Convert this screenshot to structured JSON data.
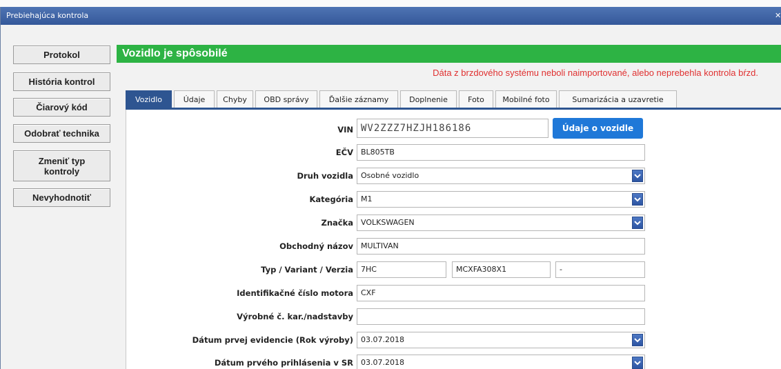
{
  "window": {
    "title": "Prebiehajúca kontrola",
    "close_icon": "close-icon"
  },
  "sidebar": {
    "items": [
      {
        "label": "Protokol"
      },
      {
        "label": "História kontrol"
      },
      {
        "label": "Čiarový kód"
      },
      {
        "label": "Odobrať technika"
      },
      {
        "label": "Zmeniť typ kontroly"
      },
      {
        "label": "Nevyhodnotiť"
      }
    ]
  },
  "status": {
    "title": "Vozidlo je spôsobilé",
    "color": "#2db344"
  },
  "warning": "Dáta z brzdového systému neboli naimportované, alebo neprebehla kontrola bŕzd.",
  "tabs": [
    {
      "label": "Vozidlo",
      "active": true
    },
    {
      "label": "Údaje"
    },
    {
      "label": "Chyby"
    },
    {
      "label": "OBD správy"
    },
    {
      "label": "Ďalšie záznamy"
    },
    {
      "label": "Doplnenie"
    },
    {
      "label": "Foto"
    },
    {
      "label": "Mobilné foto"
    },
    {
      "label": "Sumarizácia a uzavretie"
    }
  ],
  "form": {
    "vin_label": "VIN",
    "vin_value": "WV2ZZZ7HZJH186186",
    "vehicle_button": "Údaje o vozidle",
    "ecv_label": "EČV",
    "ecv_value": "BL805TB",
    "druh_label": "Druh vozidla",
    "druh_value": "Osobné vozidlo",
    "kategoria_label": "Kategória",
    "kategoria_value": "M1",
    "znacka_label": "Značka",
    "znacka_value": "VOLKSWAGEN",
    "obchodny_label": "Obchodný názov",
    "obchodny_value": "MULTIVAN",
    "typ_label": "Typ / Variant / Verzia",
    "typ_value": "7HC",
    "variant_value": "MCXFA308X1",
    "verzia_value": "-",
    "motor_label": "Identifikačné číslo motora",
    "motor_value": "CXF",
    "karoseria_label": "Výrobné č. kar./nadstavby",
    "karoseria_value": "",
    "evidencia_label": "Dátum prvej evidencie (Rok výroby)",
    "evidencia_value": "03.07.2018",
    "prihlasenie_label": "Dátum prvého prihlásenia v SR",
    "prihlasenie_value": "03.07.2018"
  },
  "colors": {
    "tab_active": "#2e5591",
    "button_blue": "#1f78d8",
    "warning_red": "#e03030",
    "titlebar": "#3f64a6"
  }
}
